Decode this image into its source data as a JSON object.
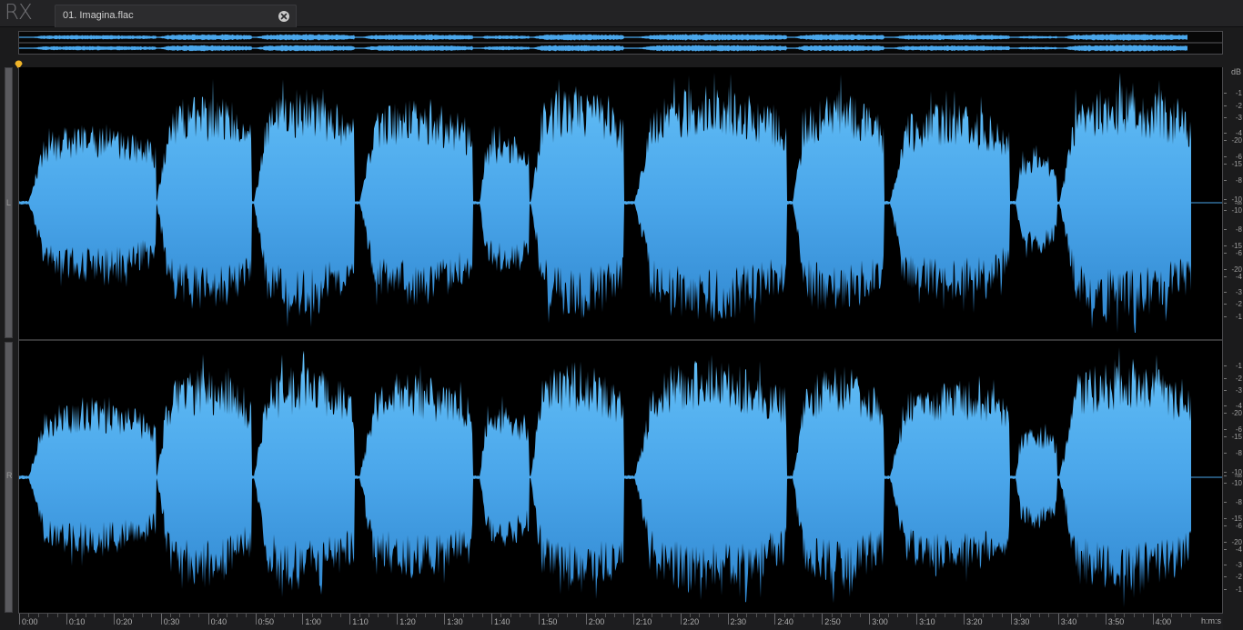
{
  "app": {
    "logo_text": "RX",
    "file_tab": {
      "label": "01. Imagina.flac",
      "close_icon": "close-circle-icon"
    },
    "playhead_icon": "playhead-marker-icon"
  },
  "channels": [
    {
      "label": "L"
    },
    {
      "label": "R"
    }
  ],
  "db_scale": {
    "unit": "dB",
    "ticks": [
      "-1",
      "-2",
      "-3",
      "-4",
      "-6",
      "-8",
      "-10",
      "-15",
      "-20",
      "-∞",
      "-20",
      "-15",
      "-10",
      "-8",
      "-6",
      "-4",
      "-3",
      "-2",
      "-1"
    ]
  },
  "time_ruler": {
    "unit": "h:m:s",
    "labels": [
      "0:00",
      "0:10",
      "0:20",
      "0:30",
      "0:40",
      "0:50",
      "1:00",
      "1:10",
      "1:20",
      "1:30",
      "1:40",
      "1:50",
      "2:00",
      "2:10",
      "2:20",
      "2:30",
      "2:40",
      "2:50",
      "3:00",
      "3:10",
      "3:20",
      "3:30",
      "3:40",
      "3:50",
      "4:00"
    ]
  },
  "colors": {
    "waveform_fill_top": "#5bb8f5",
    "waveform_fill_bottom": "#2f86cf",
    "background": "#000000",
    "playhead": "#f0b429"
  }
}
